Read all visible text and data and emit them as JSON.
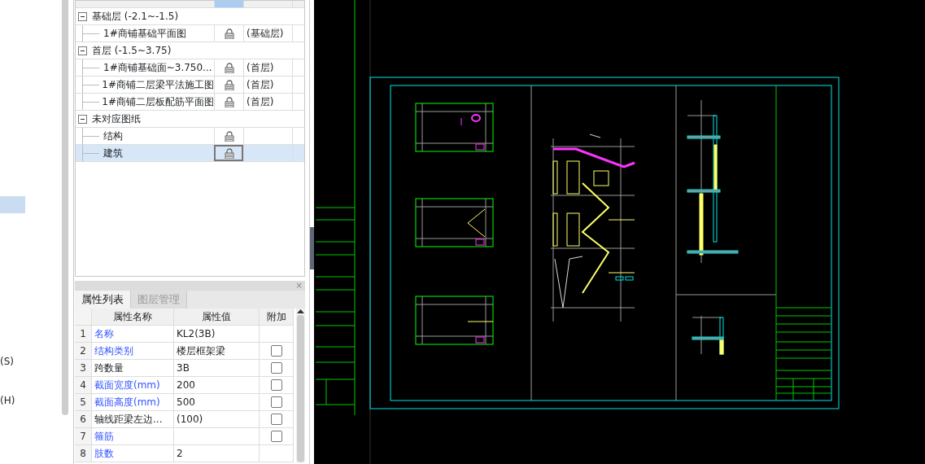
{
  "left_menu": [
    {
      "label": "(S)",
      "selected": false
    },
    {
      "label": "(H)",
      "selected": false
    }
  ],
  "drawing_tree": {
    "groups": [
      {
        "label": "基础层 (-2.1~-1.5)",
        "expanded": true,
        "children": [
          {
            "label": "1#商铺基础平面图",
            "floor": "(基础层)",
            "selected": false
          }
        ]
      },
      {
        "label": "首层 (-1.5~3.75)",
        "expanded": true,
        "children": [
          {
            "label": "1#商铺基础面~3.750...",
            "floor": "(首层)",
            "selected": false
          },
          {
            "label": "1#商铺二层梁平法施工图",
            "floor": "(首层)",
            "selected": false
          },
          {
            "label": "1#商铺二层板配筋平面图",
            "floor": "(首层)",
            "selected": false
          }
        ]
      },
      {
        "label": "未对应图纸",
        "expanded": true,
        "children": [
          {
            "label": "结构",
            "selected": false
          },
          {
            "label": "建筑",
            "selected": true
          }
        ]
      }
    ]
  },
  "properties_panel": {
    "close": "×",
    "tabs": [
      {
        "label": "属性列表",
        "selected": true
      },
      {
        "label": "图层管理",
        "selected": false
      }
    ],
    "columns": [
      "属性名称",
      "属性值",
      "附加"
    ],
    "rows": [
      {
        "num": "1",
        "name": "名称",
        "value": "KL2(3B)",
        "linked": true
      },
      {
        "num": "2",
        "name": "结构类别",
        "value": "楼层框架梁",
        "linked": true,
        "extra": {
          "checked": false
        }
      },
      {
        "num": "3",
        "name": "跨数量",
        "value": "3B",
        "linked": false,
        "extra": {
          "checked": false
        }
      },
      {
        "num": "4",
        "name": "截面宽度(mm)",
        "value": "200",
        "linked": true,
        "extra": {
          "checked": false
        }
      },
      {
        "num": "5",
        "name": "截面高度(mm)",
        "value": "500",
        "linked": true,
        "extra": {
          "checked": false
        }
      },
      {
        "num": "6",
        "name": "轴线距梁左边...",
        "value": "(100)",
        "linked": false,
        "extra": {
          "checked": false
        }
      },
      {
        "num": "7",
        "name": "箍筋",
        "value": "",
        "linked": true,
        "extra": {
          "checked": false
        }
      },
      {
        "num": "8",
        "name": "肢数",
        "value": "2",
        "linked": true
      }
    ]
  }
}
